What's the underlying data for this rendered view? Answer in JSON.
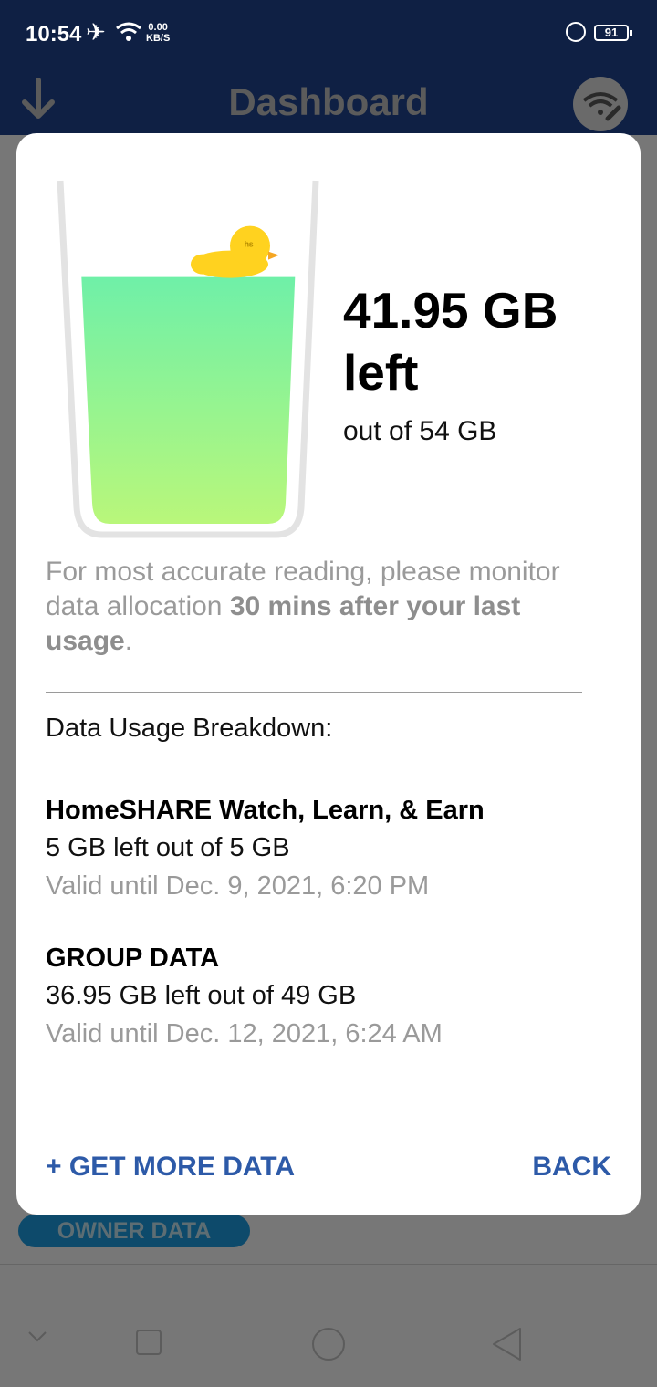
{
  "status_bar": {
    "time": "10:54",
    "speed_value": "0.00",
    "speed_unit": "KB/S",
    "battery": "91"
  },
  "app_bar": {
    "title": "Dashboard"
  },
  "modal": {
    "remaining_amount": "41.95 GB",
    "remaining_suffix": "left",
    "total": "out of 54 GB",
    "remaining_fraction": 0.777,
    "note_prefix": "For most accurate reading, please monitor data allocation ",
    "note_bold": "30 mins after your last usage",
    "note_suffix": ".",
    "breakdown_title": "Data Usage Breakdown:",
    "plans": [
      {
        "name": "HomeSHARE Watch, Learn, & Earn",
        "usage": "5 GB left out of 5 GB",
        "valid": "Valid until Dec. 9, 2021, 6:20 PM"
      },
      {
        "name": "GROUP DATA",
        "usage": "36.95 GB left out of 49 GB",
        "valid": "Valid until Dec. 12, 2021, 6:24 AM"
      }
    ],
    "get_more_label": "+ GET MORE DATA",
    "back_label": "BACK"
  },
  "background": {
    "owner_pill": "OWNER DATA"
  },
  "colors": {
    "header_navy": "#0f2044",
    "action_blue": "#2d5aa8",
    "liquid_top": "#6ff0a8",
    "liquid_bottom": "#b9f77a",
    "duck_yellow": "#ffd21f"
  },
  "icons": {
    "download": "arrow-down-icon",
    "wifi_settings": "wifi-wrench-icon",
    "duck": "rubber-duck-icon"
  }
}
